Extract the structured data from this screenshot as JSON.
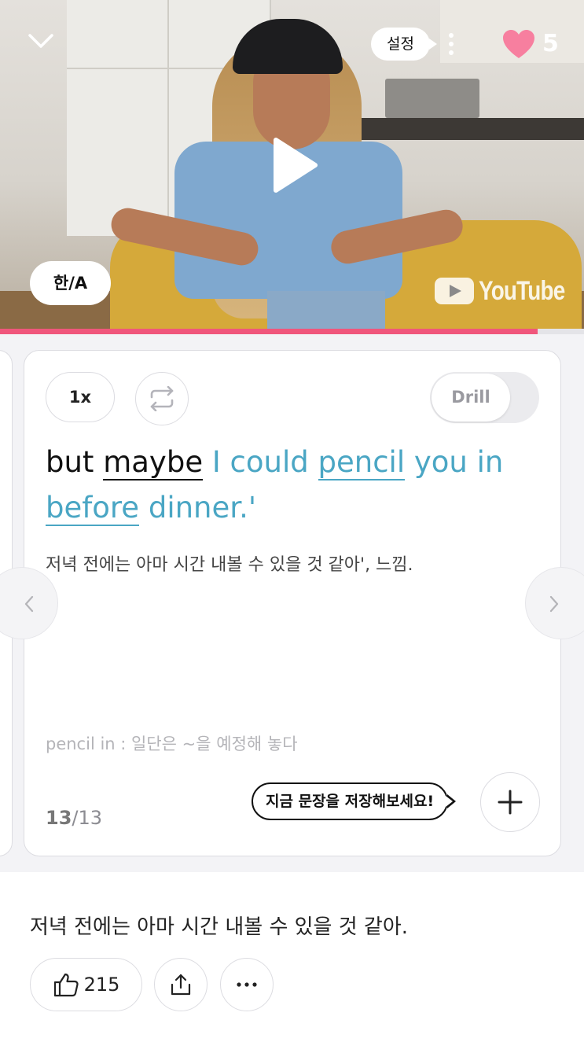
{
  "video": {
    "settings_label": "설정",
    "hearts_count": "5",
    "language_toggle_label": "한/A",
    "watermark": "YouTube",
    "progress_fraction": 0.92
  },
  "card": {
    "speed_label": "1x",
    "drill_label": "Drill",
    "sentence_words": [
      {
        "text": "but ",
        "style": "plain"
      },
      {
        "text": "maybe",
        "style": "underline"
      },
      {
        "text": " I could ",
        "style": "highlight"
      },
      {
        "text": "pencil",
        "style": "highlight-underline"
      },
      {
        "text": " you in ",
        "style": "highlight"
      },
      {
        "text": "before",
        "style": "highlight-underline"
      },
      {
        "text": " dinner.'",
        "style": "highlight"
      }
    ],
    "translation": "저녁 전에는 아마 시간 내볼 수 있을 것 같아', 느낌.",
    "vocab_note": "pencil in : 일단은 ~을 예정해 놓다",
    "page_current": "13",
    "page_total": "/13",
    "save_prompt": "지금 문장을 저장해보세요!"
  },
  "bottom": {
    "sentence": "저녁 전에는 아마 시간 내볼 수 있을 것 같아.",
    "like_count": "215"
  },
  "colors": {
    "accent_pink": "#f0567c",
    "highlight_blue": "#4aa6c4",
    "heart": "#f77f9f"
  },
  "icons": [
    "chevron-down-icon",
    "more-vertical-icon",
    "heart-icon",
    "play-icon",
    "youtube-logo-icon",
    "repeat-icon",
    "plus-icon",
    "chevron-left-icon",
    "chevron-right-icon",
    "thumbs-up-icon",
    "share-icon",
    "more-horizontal-icon"
  ]
}
